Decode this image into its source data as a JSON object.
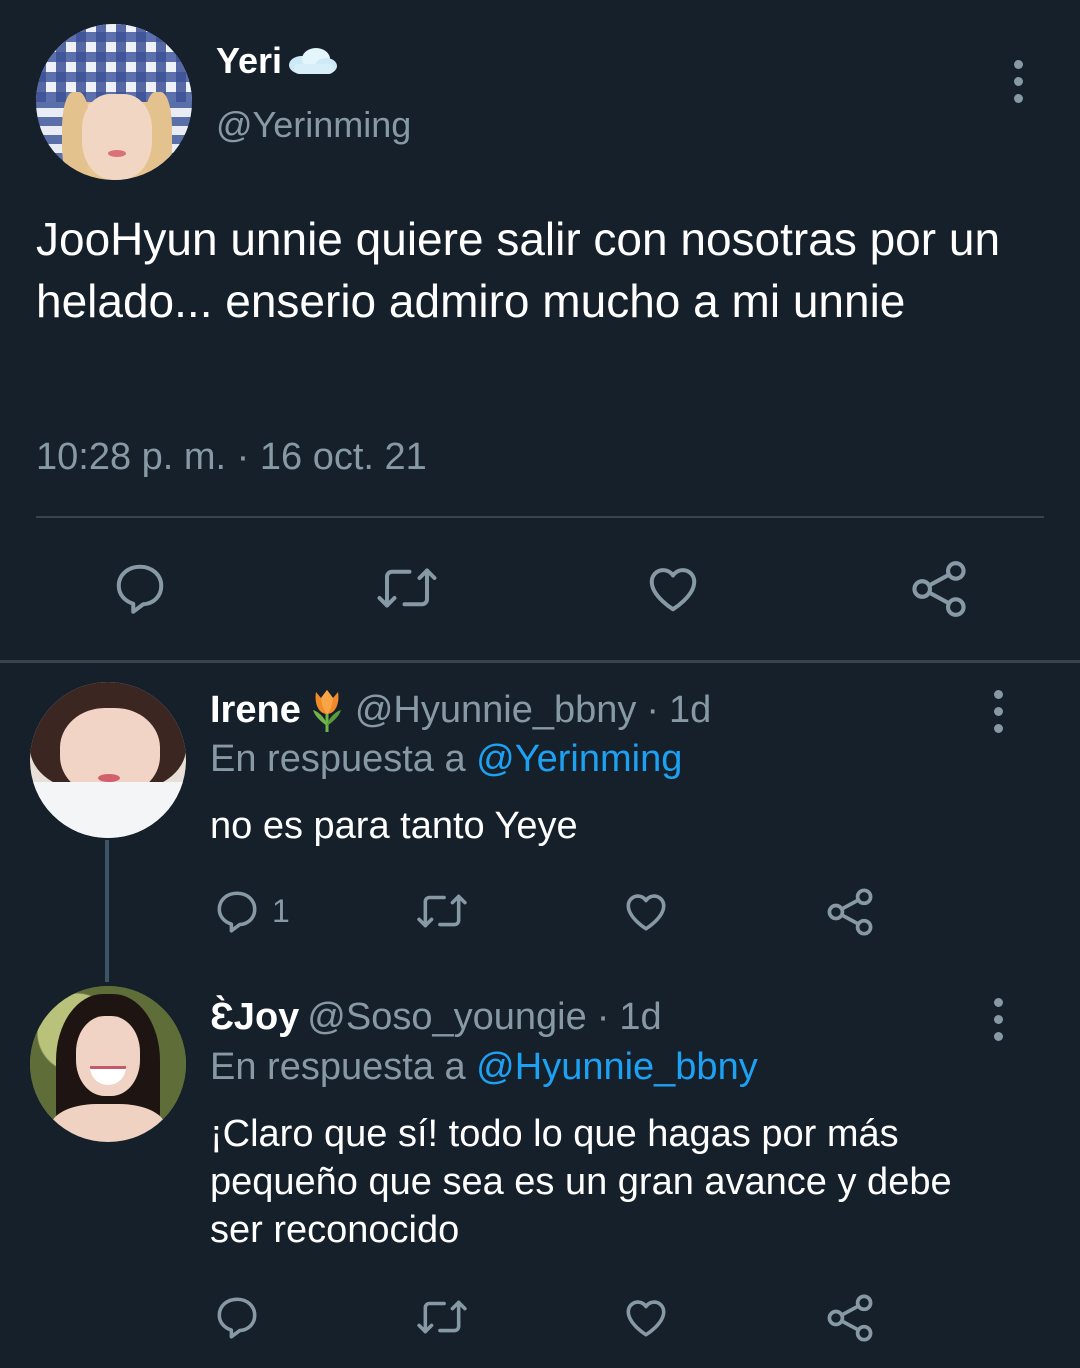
{
  "main_tweet": {
    "display_name": "Yeri",
    "name_emoji": "cloud-emoji",
    "handle": "@Yerinming",
    "text": "JooHyun unnie quiere salir con nosotras por un helado... enserio admiro mucho a mi unnie",
    "timestamp": "10:28 p. m. · 16 oct. 21",
    "actions": [
      "reply-icon",
      "retweet-icon",
      "like-icon",
      "share-icon"
    ]
  },
  "replies": [
    {
      "display_name": "Irene",
      "name_emoji": "tulip-emoji",
      "handle": "@Hyunnie_bbny",
      "separator": "·",
      "age": "1d",
      "reply_prefix": "En respuesta a",
      "reply_to": "@Yerinming",
      "text": "no es para tanto Yeye",
      "reply_count": "1"
    },
    {
      "display_name": "Ɛ̀Joy",
      "handle": "@Soso_youngie",
      "separator": "·",
      "age": "1d",
      "reply_prefix": "En respuesta a",
      "reply_to": "@Hyunnie_bbny",
      "text": "¡Claro que sí! todo lo que hagas por más pequeño que sea es un gran avance y debe ser reconocido"
    }
  ],
  "colors": {
    "background": "#15202b",
    "text": "#ffffff",
    "secondary_text": "#8899a6",
    "link": "#1da1f2",
    "divider": "#38444d"
  }
}
